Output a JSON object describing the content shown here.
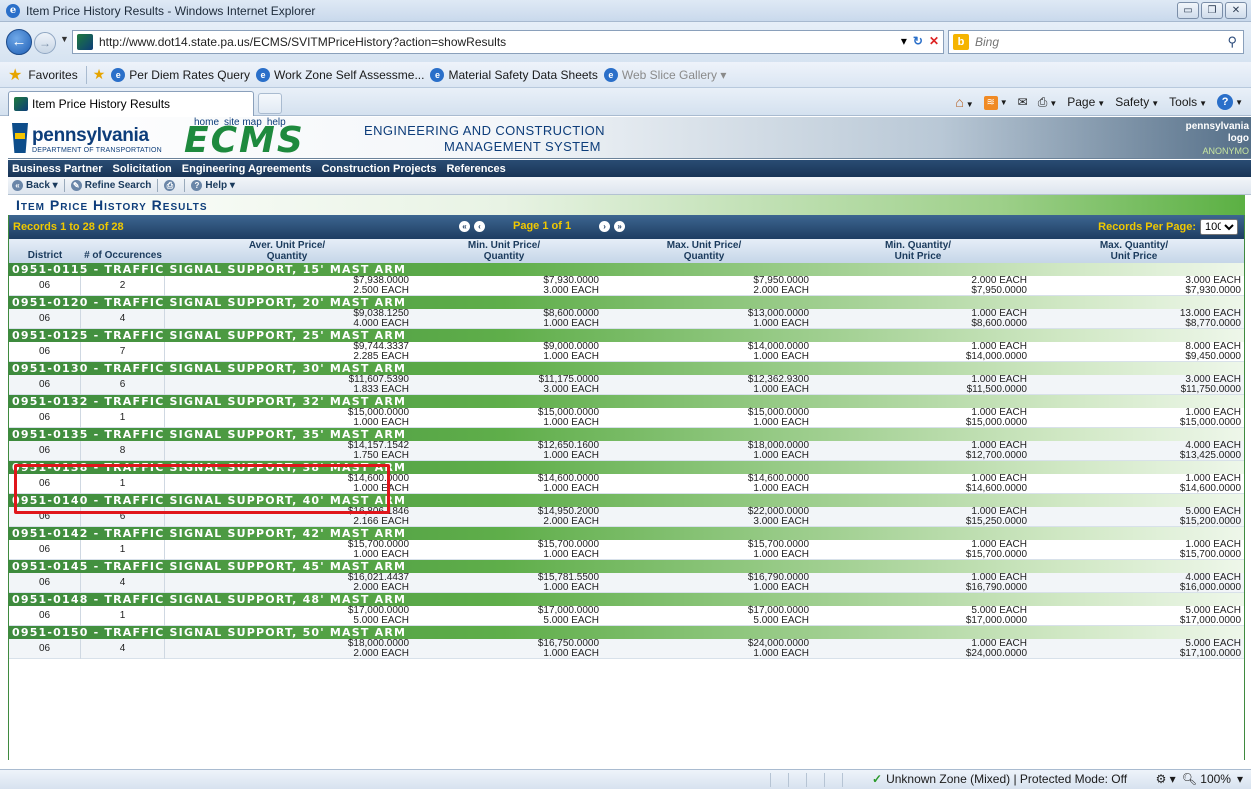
{
  "window": {
    "title": "Item Price History Results - Windows Internet Explorer",
    "buttons": [
      "▭",
      "❐",
      "✕"
    ]
  },
  "address": {
    "url": "http://www.dot14.state.pa.us/ECMS/SVITMPriceHistory?action=showResults",
    "search_placeholder": "Bing"
  },
  "favorites": {
    "label": "Favorites",
    "items": [
      {
        "label": "Per Diem Rates Query",
        "dim": false
      },
      {
        "label": "Work Zone Self Assessme...",
        "dim": false
      },
      {
        "label": "Material Safety Data Sheets",
        "dim": false
      },
      {
        "label": "Web Slice Gallery ▾",
        "dim": true
      }
    ]
  },
  "tab": {
    "label": "Item Price History Results"
  },
  "commands": {
    "page": "Page",
    "safety": "Safety",
    "tools": "Tools"
  },
  "header": {
    "toplinks": [
      "home",
      "site map",
      "help"
    ],
    "pa_word": "pennsylvania",
    "pa_dept": "DEPARTMENT OF TRANSPORTATION",
    "logo": "ECMS",
    "sys_line1": "ENGINEERING AND CONSTRUCTION",
    "sys_line2": "MANAGEMENT SYSTEM",
    "right_line1": "pennsylvania",
    "right_line2": "logo",
    "right_line3": "ANONYMO"
  },
  "menu": [
    "Business Partner",
    "Solicitation",
    "Engineering Agreements",
    "Construction Projects",
    "References"
  ],
  "toolbar": {
    "back": "Back",
    "refine": "Refine Search",
    "help": "Help"
  },
  "page_title": "Item Price History Results",
  "paging": {
    "records": "Records 1 to 28 of 28",
    "page": "Page 1 of 1",
    "per_page_label": "Records Per Page:",
    "per_page_value": "100"
  },
  "columns": {
    "district": "District",
    "occ": "# of Occurences",
    "avg": "Aver. Unit Price/",
    "avg2": "Quantity",
    "min": "Min. Unit Price/",
    "min2": "Quantity",
    "max": "Max. Unit Price/",
    "max2": "Quantity",
    "minq": "Min. Quantity/",
    "minq2": "Unit Price",
    "maxq": "Max. Quantity/",
    "maxq2": "Unit Price"
  },
  "groups": [
    {
      "title": "0951-0115  -  TRAFFIC SIGNAL SUPPORT, 15' MAST ARM",
      "district": "06",
      "occ": "2",
      "avg": [
        "$7,938.0000",
        "2.500 EACH"
      ],
      "min": [
        "$7,930.0000",
        "3.000 EACH"
      ],
      "max": [
        "$7,950.0000",
        "2.000 EACH"
      ],
      "minq": [
        "2.000 EACH",
        "$7,950.0000"
      ],
      "maxq": [
        "3.000 EACH",
        "$7,930.0000"
      ]
    },
    {
      "title": "0951-0120  -  TRAFFIC SIGNAL SUPPORT, 20' MAST ARM",
      "district": "06",
      "occ": "4",
      "avg": [
        "$9,038.1250",
        "4.000 EACH"
      ],
      "min": [
        "$8,600.0000",
        "1.000 EACH"
      ],
      "max": [
        "$13,000.0000",
        "1.000 EACH"
      ],
      "minq": [
        "1.000 EACH",
        "$8,600.0000"
      ],
      "maxq": [
        "13.000 EACH",
        "$8,770.0000"
      ]
    },
    {
      "title": "0951-0125  -  TRAFFIC SIGNAL SUPPORT, 25' MAST ARM",
      "district": "06",
      "occ": "7",
      "avg": [
        "$9,744.3337",
        "2.285 EACH"
      ],
      "min": [
        "$9,000.0000",
        "1.000 EACH"
      ],
      "max": [
        "$14,000.0000",
        "1.000 EACH"
      ],
      "minq": [
        "1.000 EACH",
        "$14,000.0000"
      ],
      "maxq": [
        "8.000 EACH",
        "$9,450.0000"
      ]
    },
    {
      "title": "0951-0130  -  TRAFFIC SIGNAL SUPPORT, 30' MAST ARM",
      "district": "06",
      "occ": "6",
      "avg": [
        "$11,607.5390",
        "1.833 EACH"
      ],
      "min": [
        "$11,175.0000",
        "3.000 EACH"
      ],
      "max": [
        "$12,362.9300",
        "1.000 EACH"
      ],
      "minq": [
        "1.000 EACH",
        "$11,500.0000"
      ],
      "maxq": [
        "3.000 EACH",
        "$11,750.0000"
      ]
    },
    {
      "title": "0951-0132  -  TRAFFIC SIGNAL SUPPORT, 32' MAST ARM",
      "district": "06",
      "occ": "1",
      "avg": [
        "$15,000.0000",
        "1.000 EACH"
      ],
      "min": [
        "$15,000.0000",
        "1.000 EACH"
      ],
      "max": [
        "$15,000.0000",
        "1.000 EACH"
      ],
      "minq": [
        "1.000 EACH",
        "$15,000.0000"
      ],
      "maxq": [
        "1.000 EACH",
        "$15,000.0000"
      ]
    },
    {
      "title": "0951-0135  -  TRAFFIC SIGNAL SUPPORT, 35' MAST ARM",
      "district": "06",
      "occ": "8",
      "avg": [
        "$14,157.1542",
        "1.750 EACH"
      ],
      "min": [
        "$12,650.1600",
        "1.000 EACH"
      ],
      "max": [
        "$18,000.0000",
        "1.000 EACH"
      ],
      "minq": [
        "1.000 EACH",
        "$12,700.0000"
      ],
      "maxq": [
        "4.000 EACH",
        "$13,425.0000"
      ]
    },
    {
      "title": "0951-0138  -  TRAFFIC SIGNAL SUPPORT, 38' MAST ARM",
      "district": "06",
      "occ": "1",
      "avg": [
        "$14,600.0000",
        "1.000 EACH"
      ],
      "min": [
        "$14,600.0000",
        "1.000 EACH"
      ],
      "max": [
        "$14,600.0000",
        "1.000 EACH"
      ],
      "minq": [
        "1.000 EACH",
        "$14,600.0000"
      ],
      "maxq": [
        "1.000 EACH",
        "$14,600.0000"
      ]
    },
    {
      "title": "0951-0140  -  TRAFFIC SIGNAL SUPPORT, 40' MAST ARM",
      "district": "06",
      "occ": "6",
      "avg": [
        "$16,806.1846",
        "2.166 EACH"
      ],
      "min": [
        "$14,950.2000",
        "2.000 EACH"
      ],
      "max": [
        "$22,000.0000",
        "3.000 EACH"
      ],
      "minq": [
        "1.000 EACH",
        "$15,250.0000"
      ],
      "maxq": [
        "5.000 EACH",
        "$15,200.0000"
      ]
    },
    {
      "title": "0951-0142  -  TRAFFIC SIGNAL SUPPORT, 42' MAST ARM",
      "district": "06",
      "occ": "1",
      "avg": [
        "$15,700.0000",
        "1.000 EACH"
      ],
      "min": [
        "$15,700.0000",
        "1.000 EACH"
      ],
      "max": [
        "$15,700.0000",
        "1.000 EACH"
      ],
      "minq": [
        "1.000 EACH",
        "$15,700.0000"
      ],
      "maxq": [
        "1.000 EACH",
        "$15,700.0000"
      ]
    },
    {
      "title": "0951-0145  -  TRAFFIC SIGNAL SUPPORT, 45' MAST ARM",
      "district": "06",
      "occ": "4",
      "avg": [
        "$16,021.4437",
        "2.000 EACH"
      ],
      "min": [
        "$15,781.5500",
        "1.000 EACH"
      ],
      "max": [
        "$16,790.0000",
        "1.000 EACH"
      ],
      "minq": [
        "1.000 EACH",
        "$16,790.0000"
      ],
      "maxq": [
        "4.000 EACH",
        "$16,000.0000"
      ]
    },
    {
      "title": "0951-0148  -  TRAFFIC SIGNAL SUPPORT, 48' MAST ARM",
      "district": "06",
      "occ": "1",
      "avg": [
        "$17,000.0000",
        "5.000 EACH"
      ],
      "min": [
        "$17,000.0000",
        "5.000 EACH"
      ],
      "max": [
        "$17,000.0000",
        "5.000 EACH"
      ],
      "minq": [
        "5.000 EACH",
        "$17,000.0000"
      ],
      "maxq": [
        "5.000 EACH",
        "$17,000.0000"
      ]
    },
    {
      "title": "0951-0150  -  TRAFFIC SIGNAL SUPPORT, 50' MAST ARM",
      "district": "06",
      "occ": "4",
      "avg": [
        "$18,000.0000",
        "2.000 EACH"
      ],
      "min": [
        "$16,750.0000",
        "1.000 EACH"
      ],
      "max": [
        "$24,000.0000",
        "1.000 EACH"
      ],
      "minq": [
        "1.000 EACH",
        "$24,000.0000"
      ],
      "maxq": [
        "5.000 EACH",
        "$17,100.0000"
      ]
    }
  ],
  "status": {
    "zone": "Unknown Zone (Mixed) | Protected Mode: Off",
    "zoom": "100%"
  },
  "colors": {
    "highlight": "#e0161b",
    "group_green": "#3d8a3d",
    "nav_blue": "#1e3d62",
    "paging_yellow": "#f0c800"
  }
}
